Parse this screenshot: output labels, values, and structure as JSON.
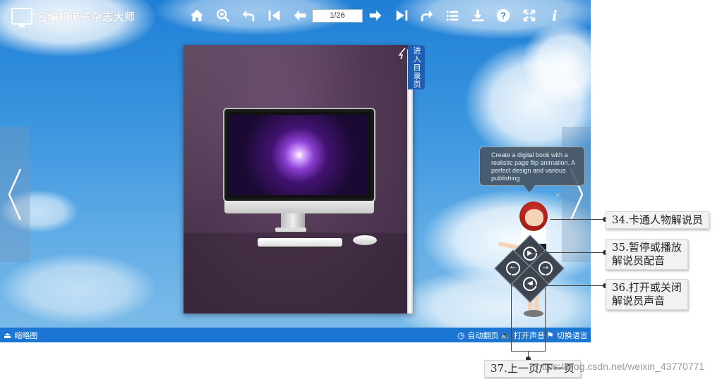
{
  "app": {
    "logo_text": "名编辑电子杂志大师"
  },
  "toolbar": {
    "page_counter": "1/26",
    "icons": [
      "home-icon",
      "zoom-in-icon",
      "undo-back-icon",
      "first-page-icon",
      "prev-page-icon",
      "next-page-icon",
      "last-page-icon",
      "share-icon",
      "list-icon",
      "download-icon",
      "help-icon",
      "fullscreen-icon",
      "info-icon"
    ]
  },
  "book": {
    "toc_tab": "进入目录页"
  },
  "bubble": {
    "text": "Create a digital book with a realistic page flip animation. A perfect design and various publishing"
  },
  "bottombar": {
    "thumbnails": "缩略图",
    "auto_flip": "自动翻页",
    "sound": "打开声音",
    "language": "切换语言"
  },
  "annotations": {
    "a34": "34.卡通人物解说员",
    "a35_line1": "35.暂停或播放",
    "a35_line2": "解说员配音",
    "a36_line1": "36.打开或关闭",
    "a36_line2": "解说员声音",
    "a37": "37.上一页/下一页"
  },
  "watermark": "https://blog.csdn.net/weixin_43770771",
  "colors": {
    "sky": "#3f98e0",
    "toolbar_bar": "#1a76d2",
    "toc_tab": "#1f5fb3"
  }
}
